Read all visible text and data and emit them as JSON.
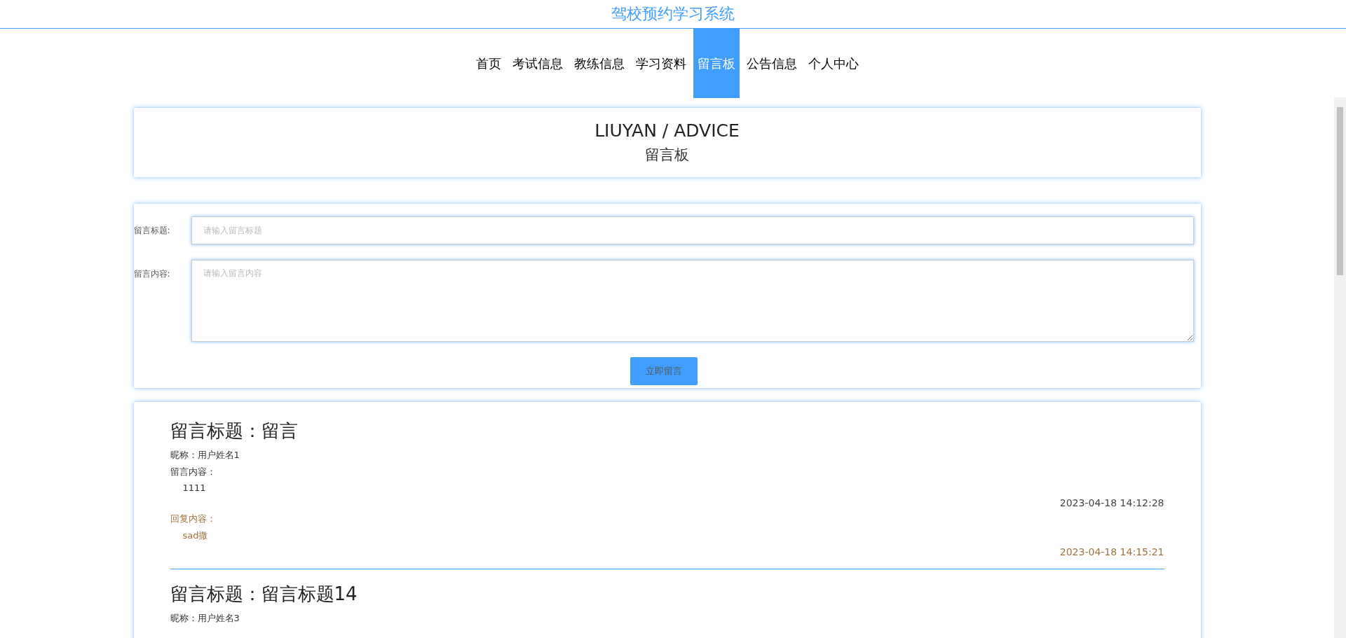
{
  "site_title": "驾校预约学习系统",
  "nav": [
    {
      "label": "首页",
      "selected": false
    },
    {
      "label": "考试信息",
      "selected": false
    },
    {
      "label": "教练信息",
      "selected": false
    },
    {
      "label": "学习资料",
      "selected": false
    },
    {
      "label": "留言板",
      "selected": true
    },
    {
      "label": "公告信息",
      "selected": false
    },
    {
      "label": "个人中心",
      "selected": false
    }
  ],
  "banner": {
    "title": "LIUYAN / ADVICE",
    "subtitle": "留言板"
  },
  "form": {
    "fields": [
      {
        "kind": "input",
        "label": "留言标题:",
        "placeholder": "请输入留言标题"
      },
      {
        "kind": "textarea",
        "label": "留言内容:",
        "placeholder": "请输入留言内容"
      }
    ],
    "submit": "立即留言"
  },
  "messages": [
    {
      "title": "留言标题：留言",
      "nickname": "昵称：用户姓名1",
      "content_label": "留言内容：",
      "content": "1111",
      "time": "2023-04-18 14:12:28",
      "reply": {
        "label": "回复内容：",
        "content": "sad撒",
        "time": "2023-04-18 14:15:21"
      }
    },
    {
      "title": "留言标题：留言标题14",
      "nickname": "昵称：用户姓名3"
    }
  ]
}
